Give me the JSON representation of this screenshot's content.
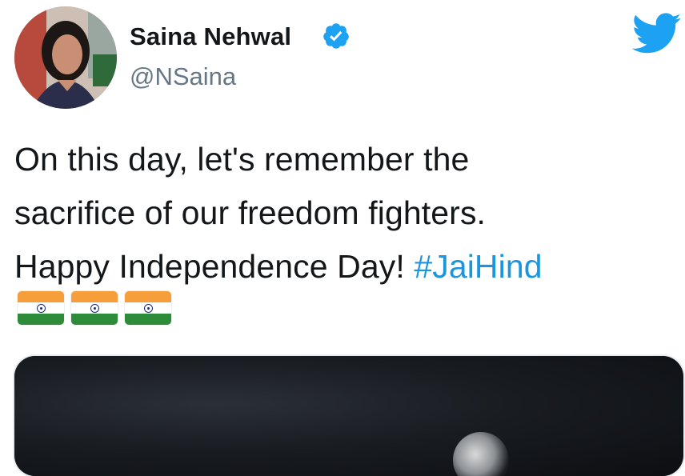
{
  "header": {
    "display_name": "Saina Nehwal",
    "handle": "@NSaina",
    "verified_icon": "verified-badge-icon",
    "brand_icon": "twitter-bird-icon",
    "brand_color": "#1da1f2"
  },
  "tweet": {
    "lines": [
      "On this day, let's remember the",
      "sacrifice of our freedom fighters.",
      "Happy Independence Day! "
    ],
    "hashtag": "#JaiHind",
    "hashtag_color": "#1b95e0",
    "emoji": [
      "india-flag-icon",
      "india-flag-icon",
      "india-flag-icon"
    ]
  },
  "media": {
    "type": "video-thumbnail"
  }
}
